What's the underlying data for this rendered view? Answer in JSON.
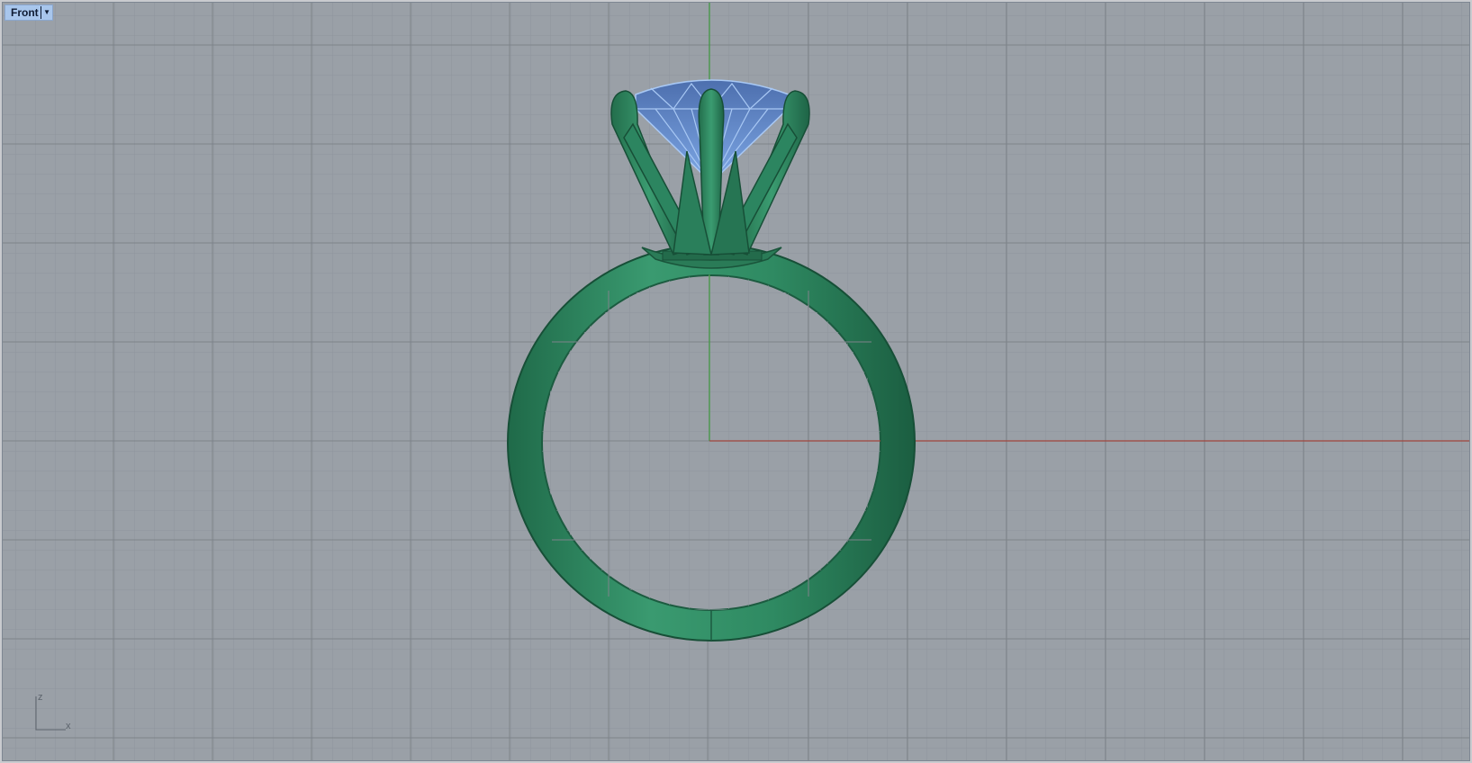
{
  "viewport": {
    "name": "Front",
    "dropdown_icon": "chevron-down-icon",
    "background_color": "#9aa0a7",
    "grid_minor_color": "#8e949b",
    "grid_major_color": "#7c8188",
    "x_axis_color": "#a0453d",
    "z_axis_color": "#3f9a3f",
    "object_color": "#2e8560",
    "gem_color": "#7ea8e6"
  },
  "axes": {
    "z_label": "z",
    "x_label": "x"
  }
}
